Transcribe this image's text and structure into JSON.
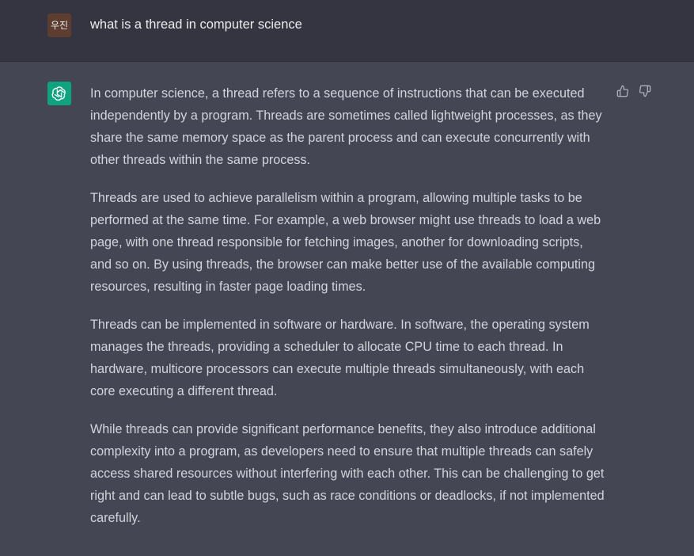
{
  "user_message": {
    "avatar_text": "우진",
    "text": "what is a thread in computer science"
  },
  "assistant_message": {
    "paragraphs": [
      "In computer science, a thread refers to a sequence of instructions that can be executed independently by a program. Threads are sometimes called lightweight processes, as they share the same memory space as the parent process and can execute concurrently with other threads within the same process.",
      "Threads are used to achieve parallelism within a program, allowing multiple tasks to be performed at the same time. For example, a web browser might use threads to load a web page, with one thread responsible for fetching images, another for downloading scripts, and so on. By using threads, the browser can make better use of the available computing resources, resulting in faster page loading times.",
      "Threads can be implemented in software or hardware. In software, the operating system manages the threads, providing a scheduler to allocate CPU time to each thread. In hardware, multicore processors can execute multiple threads simultaneously, with each core executing a different thread.",
      "While threads can provide significant performance benefits, they also introduce additional complexity into a program, as developers need to ensure that multiple threads can safely access shared resources without interfering with each other. This can be challenging to get right and can lead to subtle bugs, such as race conditions or deadlocks, if not implemented carefully."
    ],
    "feedback_icons": [
      "thumbs-up-icon",
      "thumbs-down-icon"
    ]
  },
  "colors": {
    "user_bg": "#343541",
    "assistant_bg": "#444654",
    "user_avatar_bg": "#5c3d2f",
    "assistant_avatar_bg": "#10a37f",
    "text": "#d1d5db"
  }
}
